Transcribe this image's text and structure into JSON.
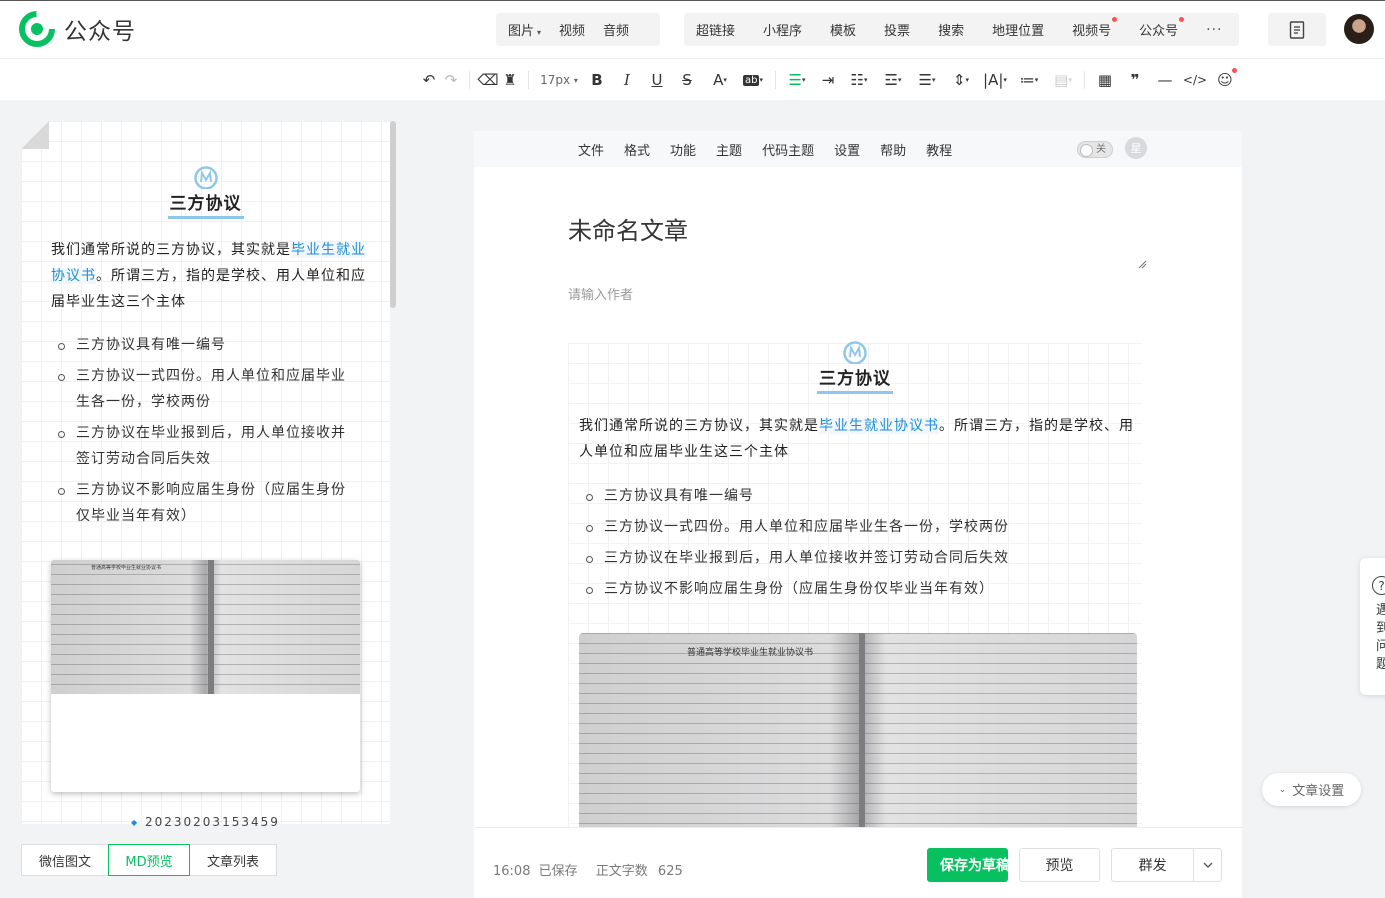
{
  "app": {
    "name": "公众号"
  },
  "top_nav": {
    "media_items": [
      {
        "label": "图片",
        "has_caret": true
      },
      {
        "label": "视频",
        "has_caret": false
      },
      {
        "label": "音频",
        "has_caret": false
      }
    ],
    "insert_items": [
      {
        "label": "超链接",
        "dot": false
      },
      {
        "label": "小程序",
        "dot": false
      },
      {
        "label": "模板",
        "dot": false
      },
      {
        "label": "投票",
        "dot": false
      },
      {
        "label": "搜索",
        "dot": false
      },
      {
        "label": "地理位置",
        "dot": false
      },
      {
        "label": "视频号",
        "dot": true
      },
      {
        "label": "公众号",
        "dot": true
      }
    ],
    "more": "···"
  },
  "format_toolbar": {
    "font_size": "17px"
  },
  "article": {
    "heading": "三方协议",
    "intro_before": "我们通常所说的三方协议，其实就是",
    "intro_highlight": "毕业生就业协议书",
    "intro_after": "。所谓三方，指的是学校、用人单位和应届毕业生这三个主体",
    "bullets": [
      "三方协议具有唯一编号",
      "三方协议一式四份。用人单位和应届毕业生各一份，学校两份",
      "三方协议在毕业报到后，用人单位接收并签订劳动合同后失效",
      "三方协议不影响应届生身份（应届生身份仅毕业当年有效）"
    ],
    "photo_heading": "普通高等学校毕业生就业协议书",
    "date_caption": "20230203153459"
  },
  "left_tabs": [
    {
      "label": "微信图文",
      "active": false
    },
    {
      "label": "MD预览",
      "active": true
    },
    {
      "label": "文章列表",
      "active": false
    }
  ],
  "editor_menu": [
    "文件",
    "格式",
    "功能",
    "主题",
    "代码主题",
    "设置",
    "帮助",
    "教程"
  ],
  "editor_toggle": {
    "label": "关",
    "badge": "星"
  },
  "editor": {
    "title_placeholder": "未命名文章",
    "author_placeholder": "请输入作者"
  },
  "status": {
    "time": "16:08",
    "saved": "已保存",
    "word_count_label": "正文字数",
    "word_count": "625"
  },
  "buttons": {
    "save_draft": "保存为草稿",
    "preview": "预览",
    "send": "群发"
  },
  "float": {
    "help_text": "遇到问题",
    "settings": "文章设置"
  },
  "colors": {
    "accent": "#07c160",
    "link": "#1f8dd6",
    "dot": "#fa5151"
  }
}
